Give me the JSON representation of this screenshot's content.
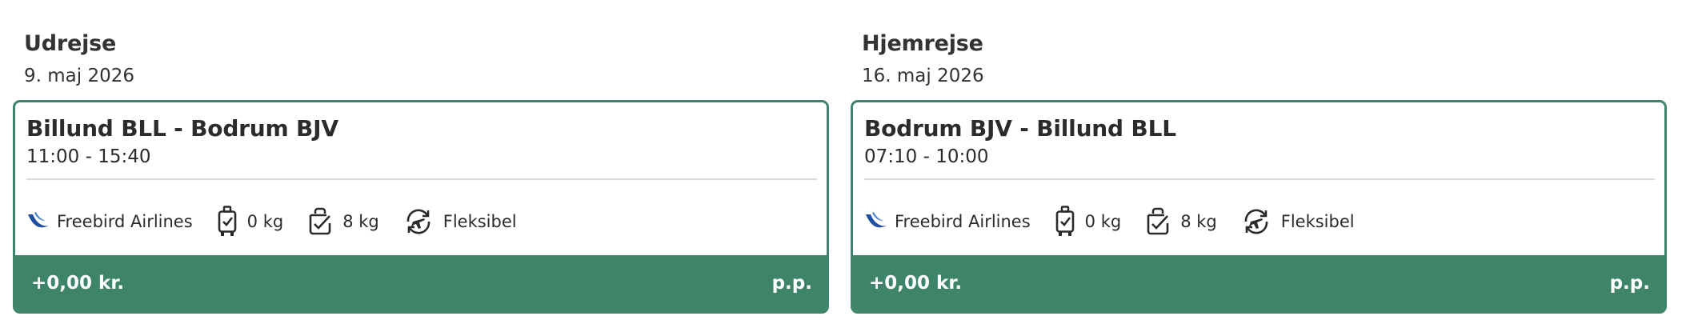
{
  "outbound": {
    "heading": "Udrejse",
    "date": "9. maj 2026",
    "route": "Billund BLL - Bodrum BJV",
    "times": "11:00 - 15:40",
    "airline": "Freebird Airlines",
    "checked_baggage": "0 kg",
    "hand_baggage": "8 kg",
    "flex_label": "Fleksibel",
    "price": "+0,00 kr.",
    "per_person": "p.p."
  },
  "inbound": {
    "heading": "Hjemrejse",
    "date": "16. maj 2026",
    "route": "Bodrum BJV - Billund BLL",
    "times": "07:10 - 10:00",
    "airline": "Freebird Airlines",
    "checked_baggage": "0 kg",
    "hand_baggage": "8 kg",
    "flex_label": "Fleksibel",
    "price": "+0,00 kr.",
    "per_person": "p.p."
  },
  "colors": {
    "accent": "#3d8468",
    "airline_logo": "#1f4fa0",
    "text": "#2b2b2b"
  },
  "icons": [
    "freebird-logo-icon",
    "suitcase-icon",
    "bag-icon",
    "flexible-ticket-icon"
  ]
}
